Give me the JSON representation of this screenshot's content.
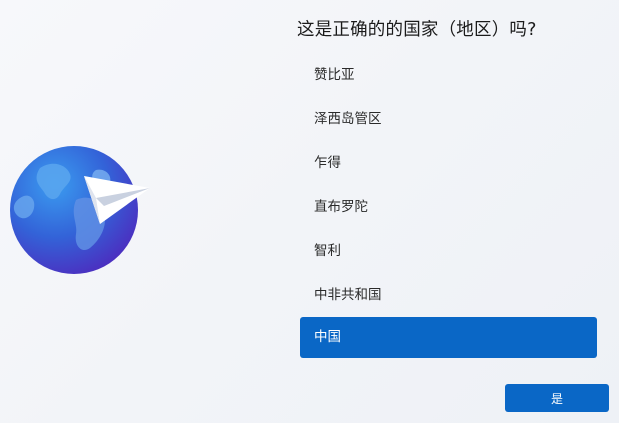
{
  "title": "这是正确的的国家（地区）吗?",
  "regions": [
    {
      "label": "赞比亚"
    },
    {
      "label": "泽西岛管区"
    },
    {
      "label": "乍得"
    },
    {
      "label": "直布罗陀"
    },
    {
      "label": "智利"
    },
    {
      "label": "中非共和国"
    },
    {
      "label": "中国"
    }
  ],
  "selected_index": 6,
  "yes_button": {
    "label": "是"
  },
  "colors": {
    "accent": "#0a67c6",
    "globe_dark": "#3a3fd0",
    "globe_light": "#2f86e6"
  },
  "icons": {
    "illustration": "globe-with-paper-plane-icon"
  }
}
